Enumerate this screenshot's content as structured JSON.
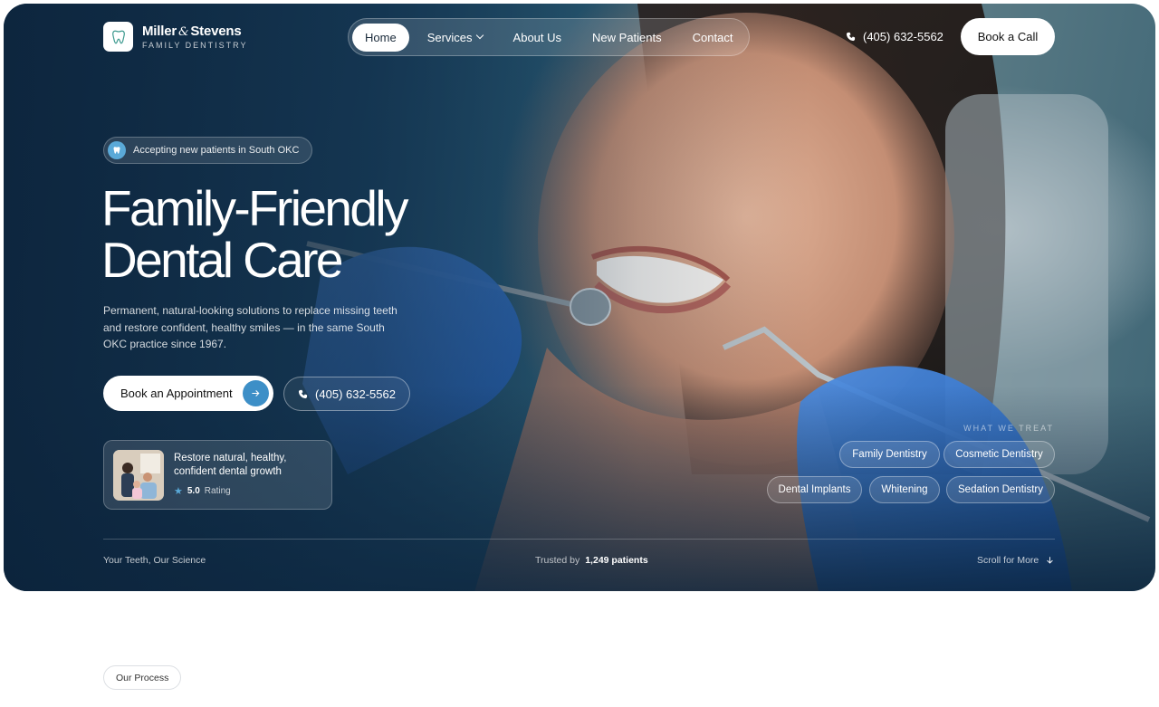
{
  "brand": {
    "name_part1": "Miller",
    "amp": "&",
    "name_part2": "Stevens",
    "subtitle": "FAMILY DENTISTRY"
  },
  "nav": {
    "items": [
      {
        "label": "Home",
        "active": true
      },
      {
        "label": "Services",
        "has_dropdown": true
      },
      {
        "label": "About Us"
      },
      {
        "label": "New Patients"
      },
      {
        "label": "Contact"
      }
    ],
    "phone": "(405) 632-5562",
    "cta": "Book a Call"
  },
  "hero": {
    "badge": "Accepting new patients in South OKC",
    "title_line1": "Family-Friendly",
    "title_line2": "Dental Care",
    "description": "Permanent, natural-looking solutions to replace missing teeth and restore confident, healthy smiles — in the same South OKC practice since 1967.",
    "primary_button": "Book an Appointment",
    "phone_button": "(405) 632-5562",
    "card": {
      "text_line1": "Restore natural, healthy,",
      "text_line2": "confident dental growth",
      "rating": "5.0",
      "rating_label": "Rating"
    },
    "treat_title": "WHAT WE TREAT",
    "treatments": [
      "Family Dentistry",
      "Cosmetic Dentistry",
      "Dental Implants",
      "Whitening",
      "Sedation Dentistry"
    ],
    "footer_left": "Your Teeth, Our Science",
    "trusted_label": "Trusted by",
    "trusted_count": "1,249 patients",
    "scroll_label": "Scroll for More"
  },
  "section": {
    "label": "Our Process"
  },
  "colors": {
    "accent": "#3d8fc7",
    "hero_dark": "#14324d",
    "glove_blue": "#2f6fd0"
  }
}
